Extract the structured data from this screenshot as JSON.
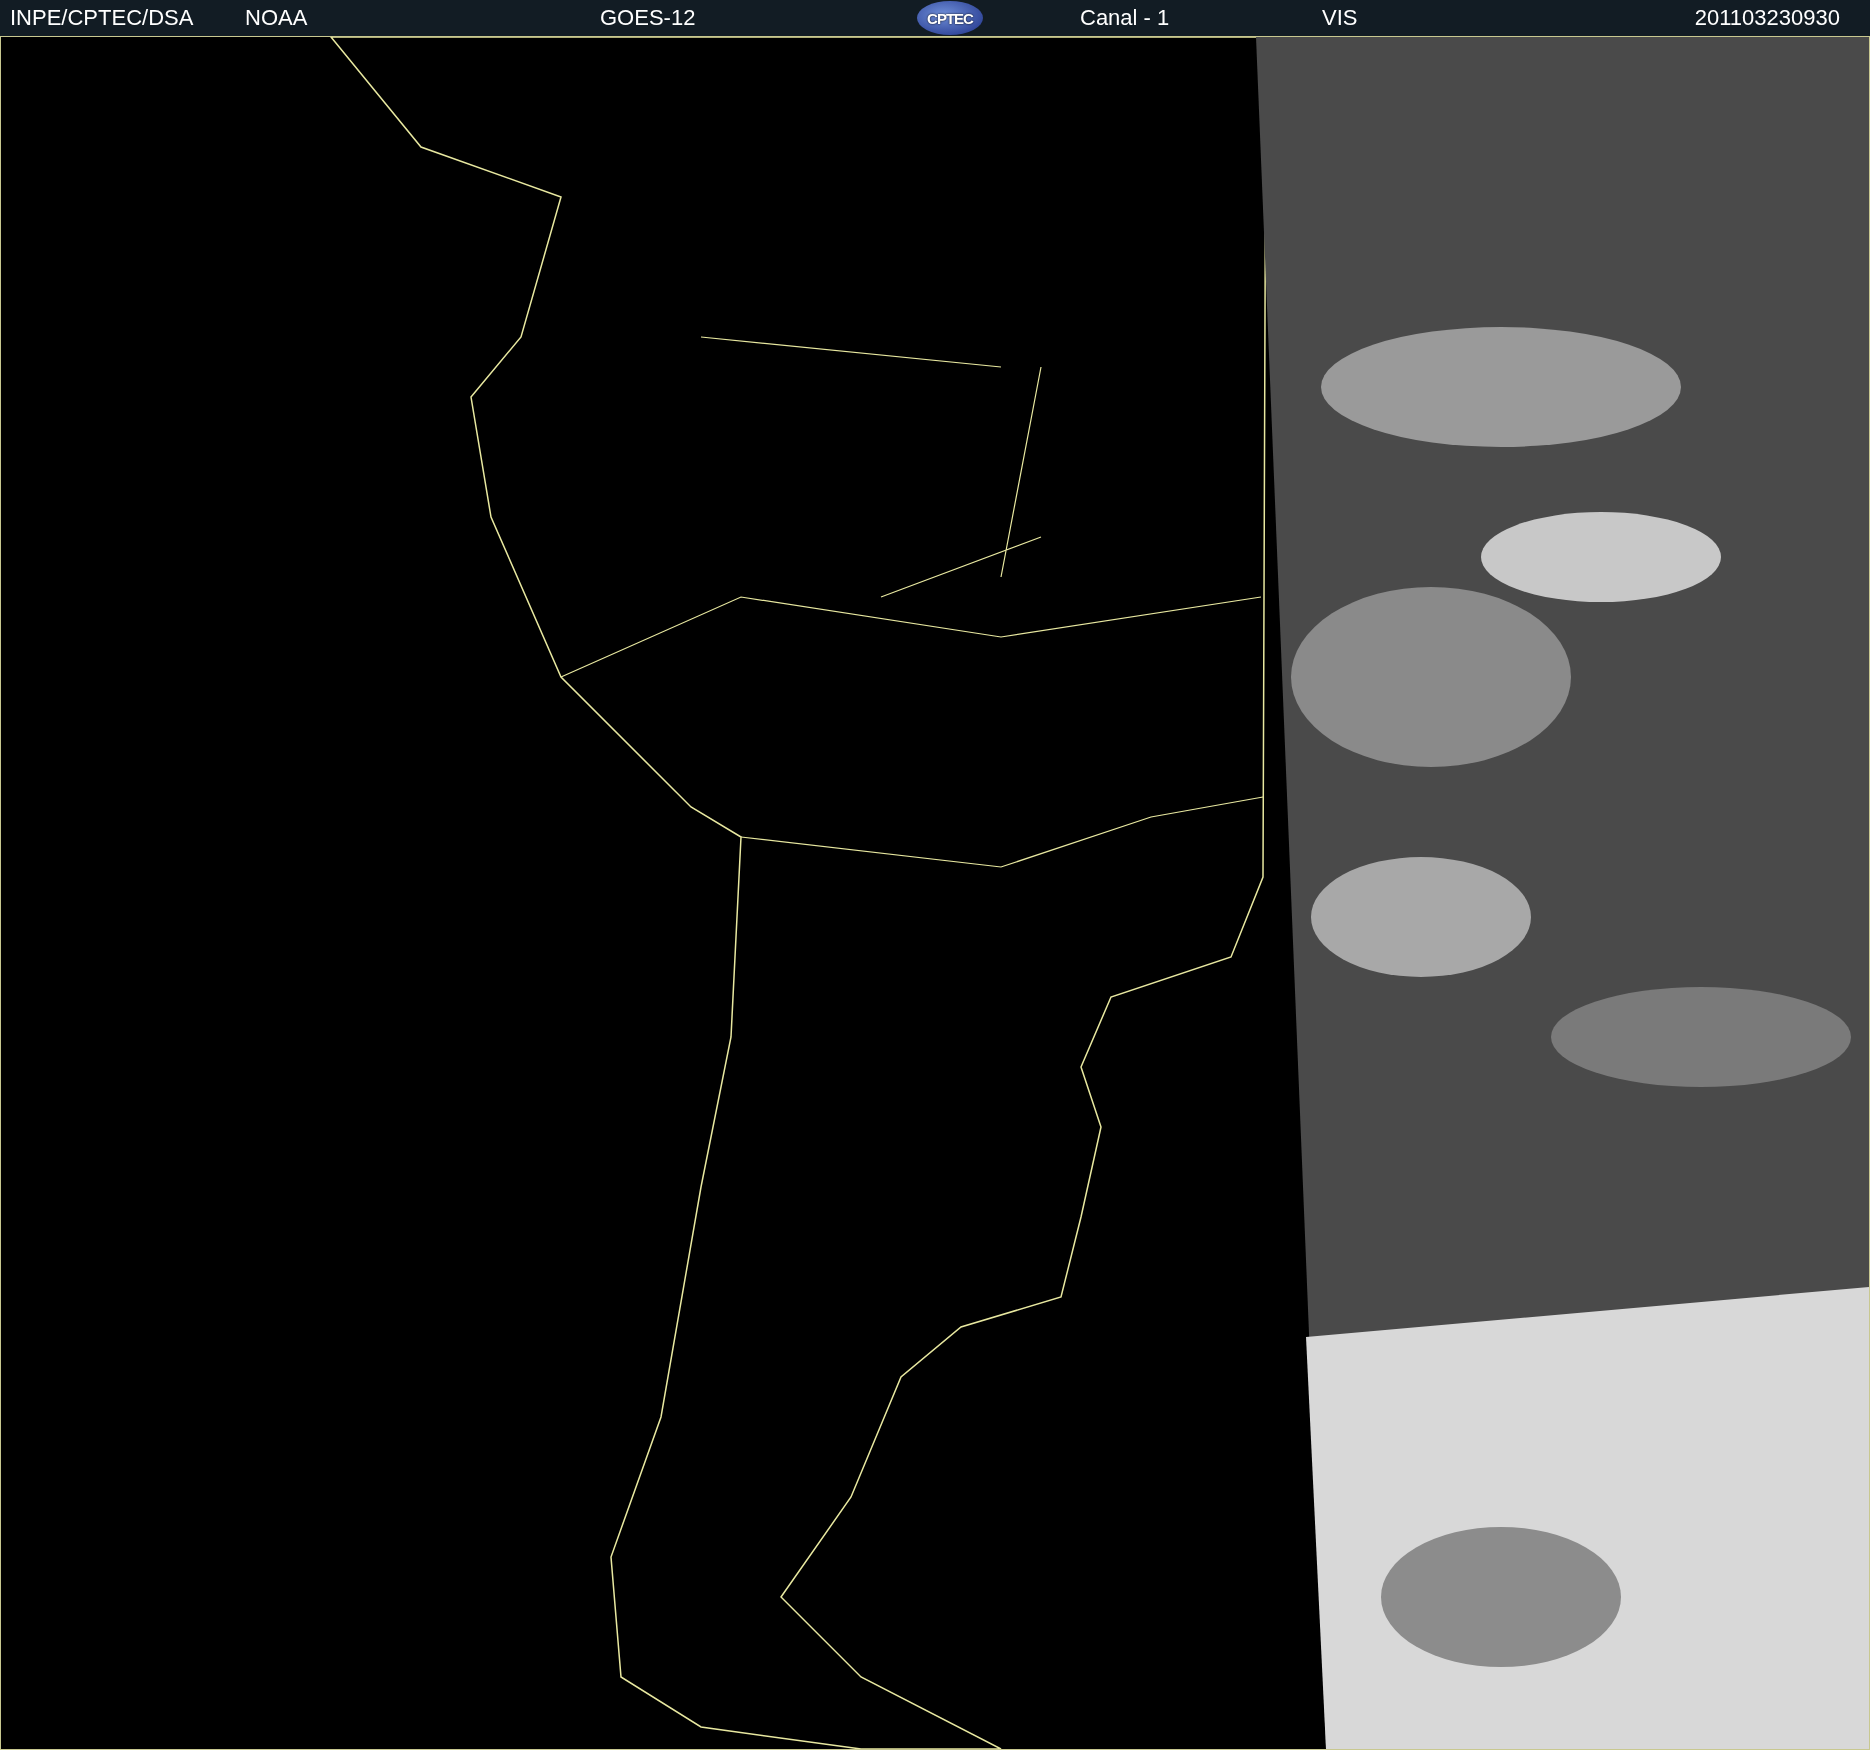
{
  "header": {
    "source": "INPE/CPTEC/DSA",
    "agency": "NOAA",
    "satellite": "GOES-12",
    "logo": "CPTEC",
    "channel": "Canal - 1",
    "band": "VIS",
    "timestamp": "201103230930"
  }
}
